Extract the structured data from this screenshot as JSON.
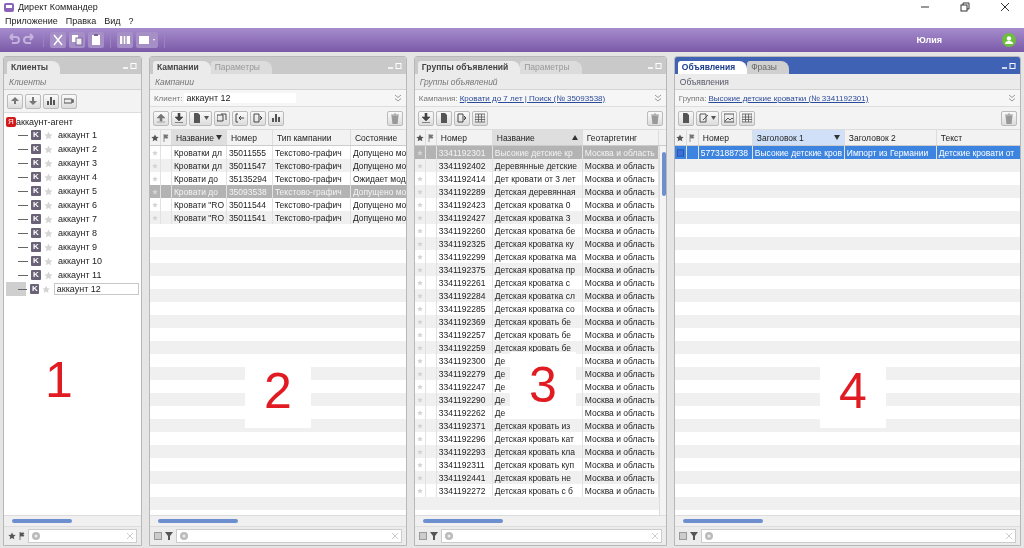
{
  "window": {
    "title": "Директ Коммандер"
  },
  "menu": [
    "Приложение",
    "Правка",
    "Вид",
    "?"
  ],
  "toolbar": {
    "user": "Юлия"
  },
  "panels": [
    {
      "kind": "tree",
      "active": false,
      "tabs": [
        {
          "label": "Клиенты",
          "selected": true
        }
      ],
      "caption": "Клиенты",
      "overlay": "1",
      "tree": {
        "badge": "Я",
        "label": "аккаунт-агент",
        "children": [
          {
            "icon_letter": "K",
            "label": "аккаунт 1",
            "selected": false
          },
          {
            "icon_letter": "K",
            "label": "аккаунт 2",
            "selected": false
          },
          {
            "icon_letter": "K",
            "label": "аккаунт 3",
            "selected": false
          },
          {
            "icon_letter": "K",
            "label": "аккаунт 4",
            "selected": false
          },
          {
            "icon_letter": "K",
            "label": "аккаунт 5",
            "selected": false
          },
          {
            "icon_letter": "K",
            "label": "аккаунт 6",
            "selected": false
          },
          {
            "icon_letter": "K",
            "label": "аккаунт 7",
            "selected": false
          },
          {
            "icon_letter": "K",
            "label": "аккаунт 8",
            "selected": false
          },
          {
            "icon_letter": "K",
            "label": "аккаунт 9",
            "selected": false
          },
          {
            "icon_letter": "K",
            "label": "аккаунт 10",
            "selected": false
          },
          {
            "icon_letter": "K",
            "label": "аккаунт 11",
            "selected": false
          },
          {
            "icon_letter": "K",
            "label": "аккаунт 12",
            "selected": true
          }
        ]
      }
    },
    {
      "kind": "table",
      "active": false,
      "tabs": [
        {
          "label": "Кампании",
          "selected": true
        },
        {
          "label": "Параметры",
          "selected": false
        }
      ],
      "caption": "Кампании",
      "overlay": "2",
      "context": {
        "kind": "field",
        "label": "Клиент:",
        "value": "аккаунт 12"
      },
      "columns": [
        {
          "label": "Название",
          "sorted": true,
          "ascending": false
        },
        {
          "label": "Номер",
          "sorted": false
        },
        {
          "label": "Тип кампании",
          "sorted": false
        },
        {
          "label": "Состояние",
          "sorted": false
        }
      ],
      "rows": [
        {
          "selected": false,
          "cells": [
            "Кроватки дл",
            "35011555",
            "Текстово-графич",
            "Допущено мо"
          ]
        },
        {
          "selected": false,
          "cells": [
            "Кроватки дл",
            "35011547",
            "Текстово-графич",
            "Допущено мо"
          ]
        },
        {
          "selected": false,
          "cells": [
            "Кровати до",
            "35135294",
            "Текстово-графич",
            "Ожидает мод"
          ]
        },
        {
          "selected": true,
          "cells": [
            "Кровати до",
            "35093538",
            "Текстово-графич",
            "Допущено мо"
          ]
        },
        {
          "selected": false,
          "cells": [
            "Кровати \"RO",
            "35011544",
            "Текстово-графич",
            "Допущено мо"
          ]
        },
        {
          "selected": false,
          "cells": [
            "Кровати \"RO",
            "35011541",
            "Текстово-графич",
            "Допущено мо"
          ]
        }
      ]
    },
    {
      "kind": "table",
      "active": false,
      "tabs": [
        {
          "label": "Группы объявлений",
          "selected": true
        },
        {
          "label": "Параметры",
          "selected": false
        }
      ],
      "caption": "Группы объявлений",
      "overlay": "3",
      "context": {
        "kind": "link",
        "label": "Кампания:",
        "value": "Кровати до 7 лет | Поиск (№ 35093538)"
      },
      "columns": [
        {
          "label": "Номер",
          "sorted": false
        },
        {
          "label": "Название",
          "sorted": true,
          "ascending": true
        },
        {
          "label": "Геотаргетинг",
          "sorted": false
        }
      ],
      "rows": [
        {
          "selected": true,
          "cells": [
            "3341192301",
            "Высокие детские кр",
            "Москва и область"
          ]
        },
        {
          "selected": false,
          "cells": [
            "3341192402",
            "Деревянные детские",
            "Москва и область"
          ]
        },
        {
          "selected": false,
          "cells": [
            "3341192414",
            "Дет кровати от 3 лет",
            "Москва и область"
          ]
        },
        {
          "selected": false,
          "cells": [
            "3341192289",
            "Детская деревянная",
            "Москва и область"
          ]
        },
        {
          "selected": false,
          "cells": [
            "3341192423",
            "Детская кроватка 0",
            "Москва и область"
          ]
        },
        {
          "selected": false,
          "cells": [
            "3341192427",
            "Детская кроватка 3",
            "Москва и область"
          ]
        },
        {
          "selected": false,
          "cells": [
            "3341192260",
            "Детская кроватка бе",
            "Москва и область"
          ]
        },
        {
          "selected": false,
          "cells": [
            "3341192325",
            "Детская кроватка ку",
            "Москва и область"
          ]
        },
        {
          "selected": false,
          "cells": [
            "3341192299",
            "Детская кроватка ма",
            "Москва и область"
          ]
        },
        {
          "selected": false,
          "cells": [
            "3341192375",
            "Детская кроватка пр",
            "Москва и область"
          ]
        },
        {
          "selected": false,
          "cells": [
            "3341192261",
            "Детская кроватка с",
            "Москва и область"
          ]
        },
        {
          "selected": false,
          "cells": [
            "3341192284",
            "Детская кроватка сл",
            "Москва и область"
          ]
        },
        {
          "selected": false,
          "cells": [
            "3341192285",
            "Детская кроватка со",
            "Москва и область"
          ]
        },
        {
          "selected": false,
          "cells": [
            "3341192369",
            "Детская кровать бе",
            "Москва и область"
          ]
        },
        {
          "selected": false,
          "cells": [
            "3341192257",
            "Детская кровать бе",
            "Москва и область"
          ]
        },
        {
          "selected": false,
          "cells": [
            "3341192259",
            "Детская кровать бе",
            "Москва и область"
          ]
        },
        {
          "selected": false,
          "cells": [
            "3341192300",
            "Де",
            "Москва и область"
          ]
        },
        {
          "selected": false,
          "cells": [
            "3341192279",
            "Де",
            "Москва и область"
          ]
        },
        {
          "selected": false,
          "cells": [
            "3341192247",
            "Де",
            "Москва и область"
          ]
        },
        {
          "selected": false,
          "cells": [
            "3341192290",
            "Де",
            "Москва и область"
          ]
        },
        {
          "selected": false,
          "cells": [
            "3341192262",
            "Де",
            "Москва и область"
          ]
        },
        {
          "selected": false,
          "cells": [
            "3341192371",
            "Детская кровать из",
            "Москва и область"
          ]
        },
        {
          "selected": false,
          "cells": [
            "3341192296",
            "Детская кровать кат",
            "Москва и область"
          ]
        },
        {
          "selected": false,
          "cells": [
            "3341192293",
            "Детская кровать кла",
            "Москва и область"
          ]
        },
        {
          "selected": false,
          "cells": [
            "3341192311",
            "Детская кровать куп",
            "Москва и область"
          ]
        },
        {
          "selected": false,
          "cells": [
            "3341192441",
            "Детская кровать не",
            "Москва и область"
          ]
        },
        {
          "selected": false,
          "cells": [
            "3341192272",
            "Детская кровать с б",
            "Москва и область"
          ]
        }
      ]
    },
    {
      "kind": "table",
      "active": true,
      "tabs": [
        {
          "label": "Объявления",
          "selected": true
        },
        {
          "label": "Фразы",
          "selected": false
        }
      ],
      "caption": "Объявления",
      "overlay": "4",
      "context": {
        "kind": "link",
        "label": "Группа:",
        "value": "Высокие детские кроватки (№ 3341192301)"
      },
      "columns": [
        {
          "label": "Номер",
          "sorted": false
        },
        {
          "label": "Заголовок 1",
          "sorted": true,
          "ascending": false
        },
        {
          "label": "Заголовок 2",
          "sorted": false
        },
        {
          "label": "Текст",
          "sorted": false
        }
      ],
      "rows": [
        {
          "selected": true,
          "cells": [
            "5773188738",
            "Высокие детские кров",
            "Импорт из Германии",
            "Детские кровати от"
          ]
        }
      ]
    }
  ]
}
